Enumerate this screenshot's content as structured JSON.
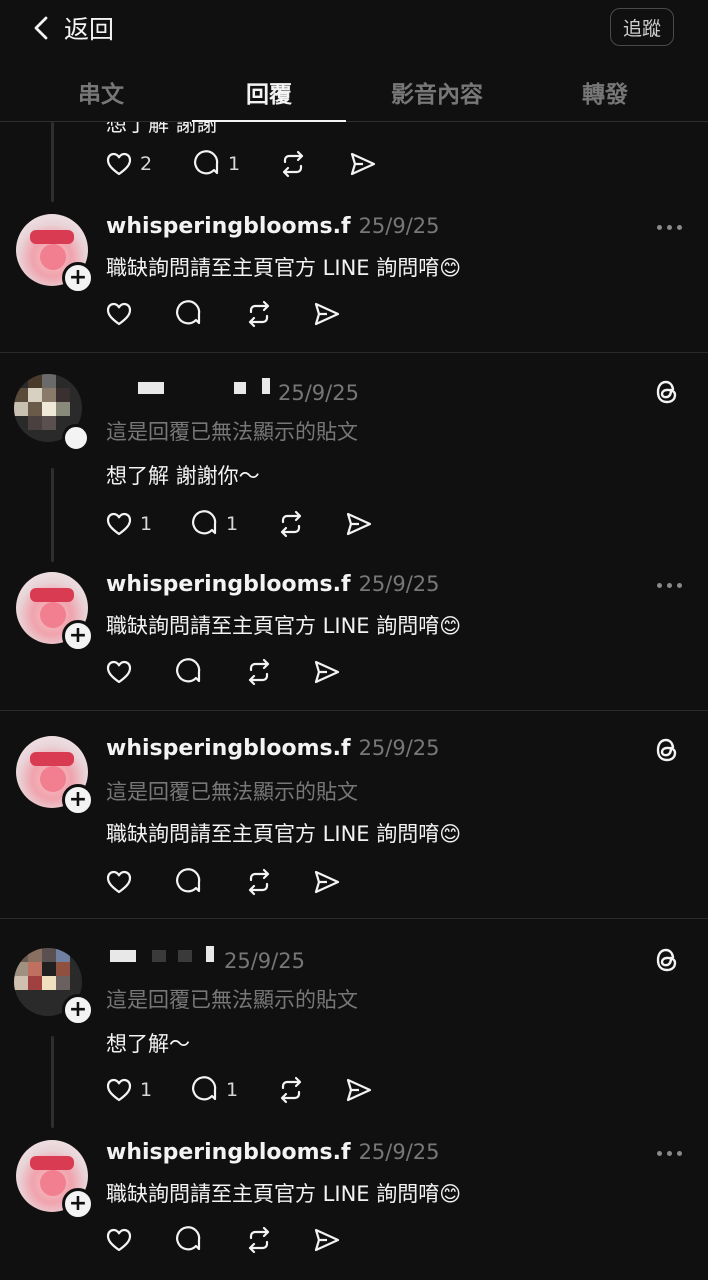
{
  "header": {
    "back_label": "返回",
    "follow_label": "追蹤"
  },
  "tabs": [
    "串文",
    "回覆",
    "影音內容",
    "轉發"
  ],
  "active_tab": "回覆",
  "partial_post": {
    "text": "想了解 謝謝",
    "likes": "2",
    "replies": "1"
  },
  "posts": [
    {
      "username": "whisperingblooms.f",
      "date": "25/9/25",
      "note": "",
      "text": "職缺詢問請至主頁官方 LINE 詢問唷😊",
      "likes": "",
      "replies": "",
      "menu": "more-icon"
    },
    {
      "username": "",
      "date": "25/9/25",
      "note": "這是回覆已無法顯示的貼文",
      "text": "想了解 謝謝你～",
      "likes": "1",
      "replies": "1",
      "menu": "threads-icon"
    },
    {
      "username": "whisperingblooms.f",
      "date": "25/9/25",
      "note": "",
      "text": "職缺詢問請至主頁官方 LINE 詢問唷😊",
      "likes": "",
      "replies": "",
      "menu": "more-icon"
    },
    {
      "username": "whisperingblooms.f",
      "date": "25/9/25",
      "note": "這是回覆已無法顯示的貼文",
      "text": "職缺詢問請至主頁官方 LINE 詢問唷😊",
      "likes": "",
      "replies": "",
      "menu": "threads-icon"
    },
    {
      "username": "",
      "date": "25/9/25",
      "note": "這是回覆已無法顯示的貼文",
      "text": "想了解～",
      "likes": "1",
      "replies": "1",
      "menu": "threads-icon"
    },
    {
      "username": "whisperingblooms.f",
      "date": "25/9/25",
      "note": "",
      "text": "職缺詢問請至主頁官方 LINE 詢問唷😊",
      "likes": "",
      "replies": "",
      "menu": "more-icon"
    }
  ],
  "colors": {
    "background": "#101010",
    "text": "#f3f3f3",
    "muted": "#777777"
  }
}
